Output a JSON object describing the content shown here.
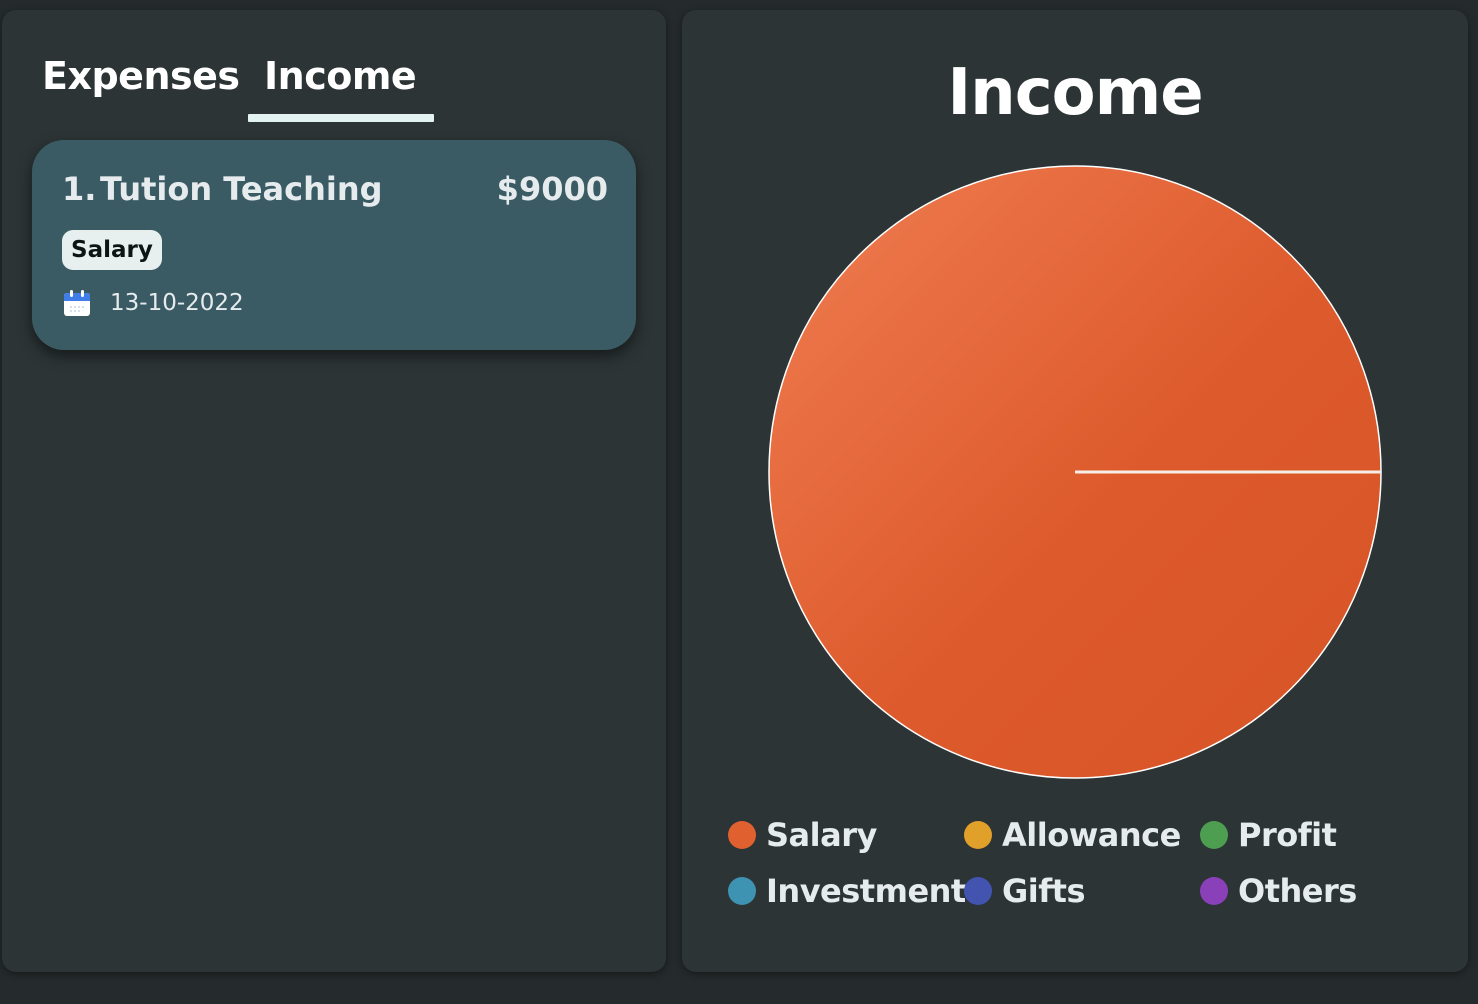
{
  "tabs": [
    {
      "label": "Expenses",
      "active": false
    },
    {
      "label": "Income",
      "active": true
    }
  ],
  "transactions": [
    {
      "index": "1.",
      "title": "Tution Teaching",
      "amount": "$9000",
      "category": "Salary",
      "date": "13-10-2022",
      "icon": "calendar-icon"
    }
  ],
  "chart_data": {
    "type": "pie",
    "title": "Income",
    "categories": [
      "Salary",
      "Allowance",
      "Profit",
      "Investment",
      "Gifts",
      "Others"
    ],
    "values": [
      9000,
      0,
      0,
      0,
      0,
      0
    ],
    "colors": [
      "#e0602f",
      "#e0a02a",
      "#4e9e52",
      "#3e92b2",
      "#4254b0",
      "#8a40b8"
    ],
    "legend_position": "bottom"
  },
  "colors": {
    "background": "#252b2c",
    "panel": "#2c3435",
    "card": "#3b5b64",
    "tab_underline": "#e3f3f0",
    "text": "#ffffff"
  }
}
